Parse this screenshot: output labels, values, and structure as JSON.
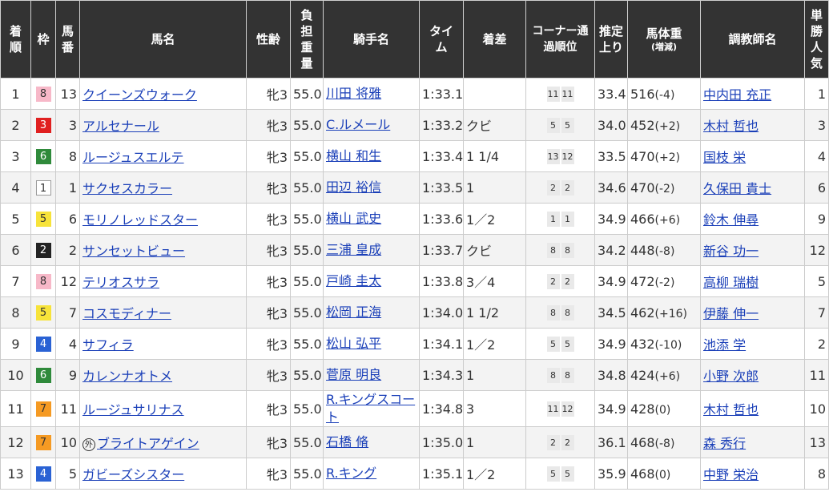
{
  "headers": {
    "rank": "着順",
    "waku": "枠",
    "umaban": "馬番",
    "horse": "馬名",
    "sexage": "性齢",
    "weight": "負担重量",
    "jockey": "騎手名",
    "time": "タイム",
    "margin": "着差",
    "corner": "コーナー通過順位",
    "last3f": "推定上り",
    "bodyweight": "馬体重",
    "bodyweight_sub": "(増減)",
    "trainer": "調教師名",
    "pop": "単勝人気"
  },
  "colors": {
    "header_bg": "#333333",
    "link": "#1a3fb8",
    "alt_row": "#f3f3f3"
  },
  "rows": [
    {
      "rank": "1",
      "waku": "8",
      "umaban": "13",
      "horse": "クイーンズウォーク",
      "mark": "",
      "sexage": "牝3",
      "weight": "55.0",
      "jockey": "川田 将雅",
      "time": "1:33.1",
      "margin": "",
      "c1": "11",
      "c2": "11",
      "last3f": "33.4",
      "bw": "516",
      "bwdiff": "(-4)",
      "trainer": "中内田 充正",
      "pop": "1"
    },
    {
      "rank": "2",
      "waku": "3",
      "umaban": "3",
      "horse": "アルセナール",
      "mark": "",
      "sexage": "牝3",
      "weight": "55.0",
      "jockey": "C.ルメール",
      "time": "1:33.2",
      "margin": "クビ",
      "c1": "5",
      "c2": "5",
      "last3f": "34.0",
      "bw": "452",
      "bwdiff": "(+2)",
      "trainer": "木村 哲也",
      "pop": "3"
    },
    {
      "rank": "3",
      "waku": "6",
      "umaban": "8",
      "horse": "ルージュスエルテ",
      "mark": "",
      "sexage": "牝3",
      "weight": "55.0",
      "jockey": "横山 和生",
      "time": "1:33.4",
      "margin": "1 1/4",
      "c1": "13",
      "c2": "12",
      "last3f": "33.5",
      "bw": "470",
      "bwdiff": "(+2)",
      "trainer": "国枝 栄",
      "pop": "4"
    },
    {
      "rank": "4",
      "waku": "1",
      "umaban": "1",
      "horse": "サクセスカラー",
      "mark": "",
      "sexage": "牝3",
      "weight": "55.0",
      "jockey": "田辺 裕信",
      "time": "1:33.5",
      "margin": "1",
      "c1": "2",
      "c2": "2",
      "last3f": "34.6",
      "bw": "470",
      "bwdiff": "(-2)",
      "trainer": "久保田 貴士",
      "pop": "6"
    },
    {
      "rank": "5",
      "waku": "5",
      "umaban": "6",
      "horse": "モリノレッドスター",
      "mark": "",
      "sexage": "牝3",
      "weight": "55.0",
      "jockey": "横山 武史",
      "time": "1:33.6",
      "margin": "1／2",
      "c1": "1",
      "c2": "1",
      "last3f": "34.9",
      "bw": "466",
      "bwdiff": "(+6)",
      "trainer": "鈴木 伸尋",
      "pop": "9"
    },
    {
      "rank": "6",
      "waku": "2",
      "umaban": "2",
      "horse": "サンセットビュー",
      "mark": "",
      "sexage": "牝3",
      "weight": "55.0",
      "jockey": "三浦 皇成",
      "time": "1:33.7",
      "margin": "クビ",
      "c1": "8",
      "c2": "8",
      "last3f": "34.2",
      "bw": "448",
      "bwdiff": "(-8)",
      "trainer": "新谷 功一",
      "pop": "12"
    },
    {
      "rank": "7",
      "waku": "8",
      "umaban": "12",
      "horse": "テリオスサラ",
      "mark": "",
      "sexage": "牝3",
      "weight": "55.0",
      "jockey": "戸崎 圭太",
      "time": "1:33.8",
      "margin": "3／4",
      "c1": "2",
      "c2": "2",
      "last3f": "34.9",
      "bw": "472",
      "bwdiff": "(-2)",
      "trainer": "高柳 瑞樹",
      "pop": "5"
    },
    {
      "rank": "8",
      "waku": "5",
      "umaban": "7",
      "horse": "コスモディナー",
      "mark": "",
      "sexage": "牝3",
      "weight": "55.0",
      "jockey": "松岡 正海",
      "time": "1:34.0",
      "margin": "1 1/2",
      "c1": "8",
      "c2": "8",
      "last3f": "34.5",
      "bw": "462",
      "bwdiff": "(+16)",
      "trainer": "伊藤 伸一",
      "pop": "7"
    },
    {
      "rank": "9",
      "waku": "4",
      "umaban": "4",
      "horse": "サフィラ",
      "mark": "",
      "sexage": "牝3",
      "weight": "55.0",
      "jockey": "松山 弘平",
      "time": "1:34.1",
      "margin": "1／2",
      "c1": "5",
      "c2": "5",
      "last3f": "34.9",
      "bw": "432",
      "bwdiff": "(-10)",
      "trainer": "池添 学",
      "pop": "2"
    },
    {
      "rank": "10",
      "waku": "6",
      "umaban": "9",
      "horse": "カレンナオトメ",
      "mark": "",
      "sexage": "牝3",
      "weight": "55.0",
      "jockey": "菅原 明良",
      "time": "1:34.3",
      "margin": "1",
      "c1": "8",
      "c2": "8",
      "last3f": "34.8",
      "bw": "424",
      "bwdiff": "(+6)",
      "trainer": "小野 次郎",
      "pop": "11"
    },
    {
      "rank": "11",
      "waku": "7",
      "umaban": "11",
      "horse": "ルージュサリナス",
      "mark": "",
      "sexage": "牝3",
      "weight": "55.0",
      "jockey": "R.キングスコート",
      "time": "1:34.8",
      "margin": "3",
      "c1": "11",
      "c2": "12",
      "last3f": "34.9",
      "bw": "428",
      "bwdiff": "(0)",
      "trainer": "木村 哲也",
      "pop": "10"
    },
    {
      "rank": "12",
      "waku": "7",
      "umaban": "10",
      "horse": "ブライトアゲイン",
      "mark": "外",
      "sexage": "牝3",
      "weight": "55.0",
      "jockey": "石橋 脩",
      "time": "1:35.0",
      "margin": "1",
      "c1": "2",
      "c2": "2",
      "last3f": "36.1",
      "bw": "468",
      "bwdiff": "(-8)",
      "trainer": "森 秀行",
      "pop": "13"
    },
    {
      "rank": "13",
      "waku": "4",
      "umaban": "5",
      "horse": "ガビーズシスター",
      "mark": "",
      "sexage": "牝3",
      "weight": "55.0",
      "jockey": "R.キング",
      "time": "1:35.1",
      "margin": "1／2",
      "c1": "5",
      "c2": "5",
      "last3f": "35.9",
      "bw": "468",
      "bwdiff": "(0)",
      "trainer": "中野 栄治",
      "pop": "8"
    }
  ]
}
